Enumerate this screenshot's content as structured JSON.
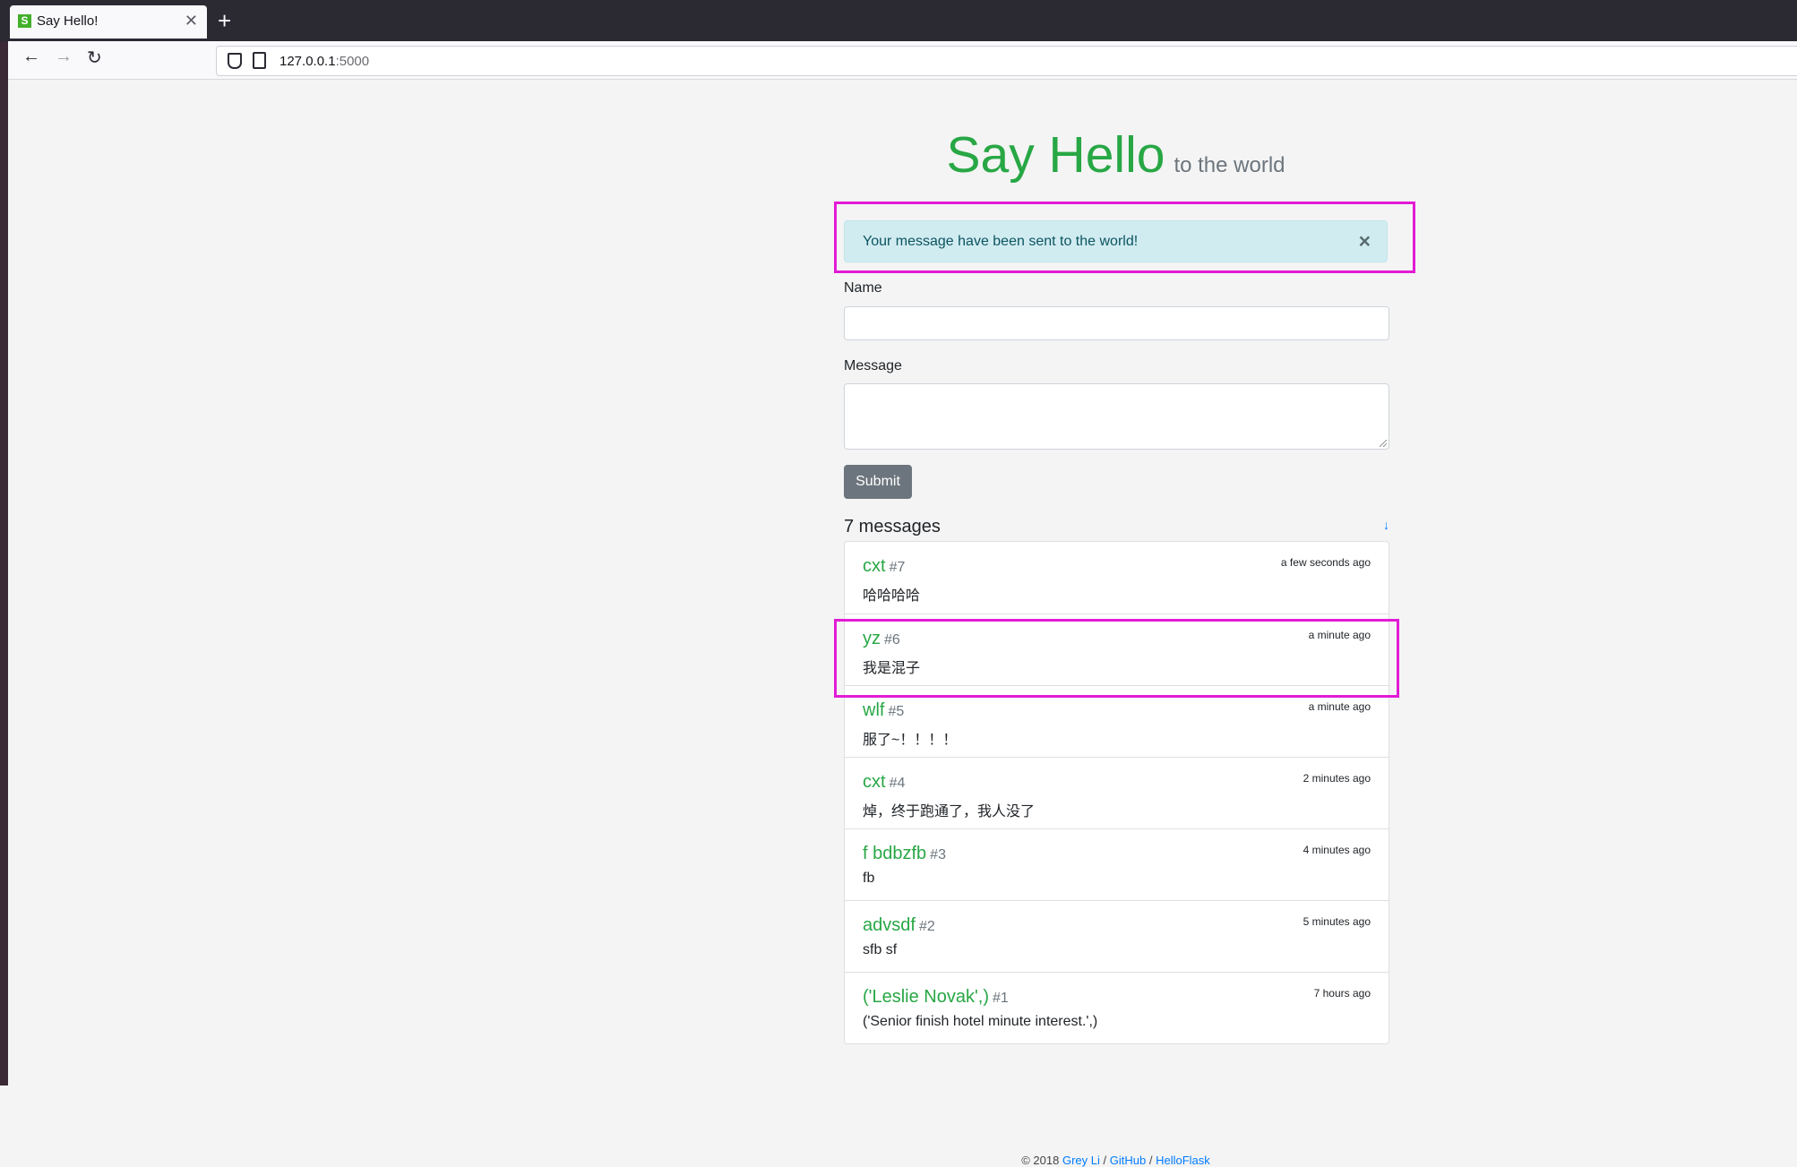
{
  "browser": {
    "tab_title": "Say Hello!",
    "tab_favicon": "S",
    "url_host": "127.0.0.1",
    "url_port": ":5000"
  },
  "page": {
    "title": "Say Hello",
    "subtitle": "to the world",
    "alert": "Your message have been sent to the world!",
    "alert_close": "×",
    "name_label": "Name",
    "message_label": "Message",
    "submit_label": "Submit",
    "count_label": "7 messages",
    "down_link": "↓",
    "footer": {
      "prefix": "© 2018",
      "author": "Grey Li",
      "sep1": "/",
      "github": "GitHub",
      "sep2": "/",
      "project": "HelloFlask"
    }
  },
  "messages": [
    {
      "name": "cxt",
      "num": "#7",
      "time": "a few seconds ago",
      "body": "哈哈哈哈"
    },
    {
      "name": "yz",
      "num": "#6",
      "time": "a minute ago",
      "body": "我是混子"
    },
    {
      "name": "wlf",
      "num": "#5",
      "time": "a minute ago",
      "body": "服了~！！！！"
    },
    {
      "name": "cxt",
      "num": "#4",
      "time": "2 minutes ago",
      "body": "焯，终于跑通了，我人没了"
    },
    {
      "name": "f bdbzfb",
      "num": "#3",
      "time": "4 minutes ago",
      "body": "fb"
    },
    {
      "name": "advsdf",
      "num": "#2",
      "time": "5 minutes ago",
      "body": "sfb sf"
    },
    {
      "name": "('Leslie Novak',)",
      "num": "#1",
      "time": "7 hours ago",
      "body": "('Senior finish hotel minute interest.',)"
    }
  ],
  "colors": {
    "accent": "#28a745",
    "highlight": "#e21bd5",
    "alert_bg": "#d1ecf1",
    "button": "#6c757d"
  }
}
